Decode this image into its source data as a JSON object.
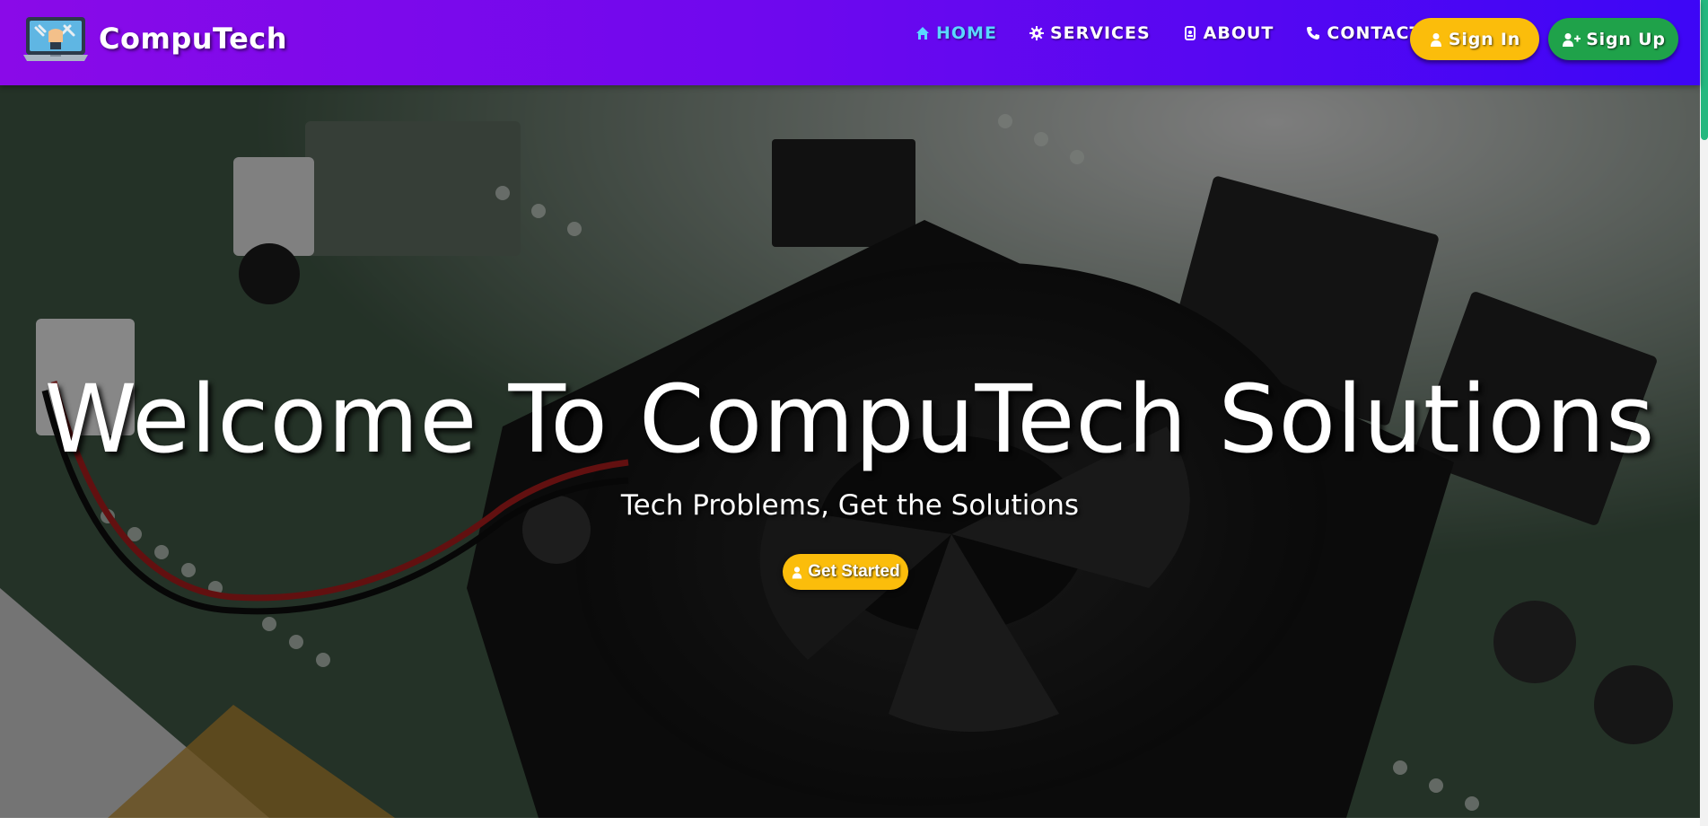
{
  "brand": {
    "name": "CompuTech",
    "logo_icon": "computer-repair-logo"
  },
  "nav": {
    "items": [
      {
        "label": "HOME",
        "icon": "home-icon",
        "active": true
      },
      {
        "label": "SERVICES",
        "icon": "gear-icon"
      },
      {
        "label": "ABOUT",
        "icon": "id-badge-icon"
      },
      {
        "label": "CONTACT",
        "icon": "phone-icon"
      }
    ],
    "signin_label": "Sign In",
    "signup_label": "Sign Up"
  },
  "hero": {
    "title": "Welcome To CompuTech Solutions",
    "subtitle": "Tech Problems, Get the Solutions",
    "cta_label": "Get Started",
    "background_icon": "circuit-board-fan-photo"
  },
  "colors": {
    "nav_gradient_start": "#8a0ae8",
    "nav_gradient_end": "#3d06f6",
    "active_link": "#5ad7ff",
    "signin_button": "#fbbd0b",
    "signup_button": "#1fa24a",
    "cta_button": "#fbbd0b",
    "scroll_thumb": "#25b87f"
  }
}
